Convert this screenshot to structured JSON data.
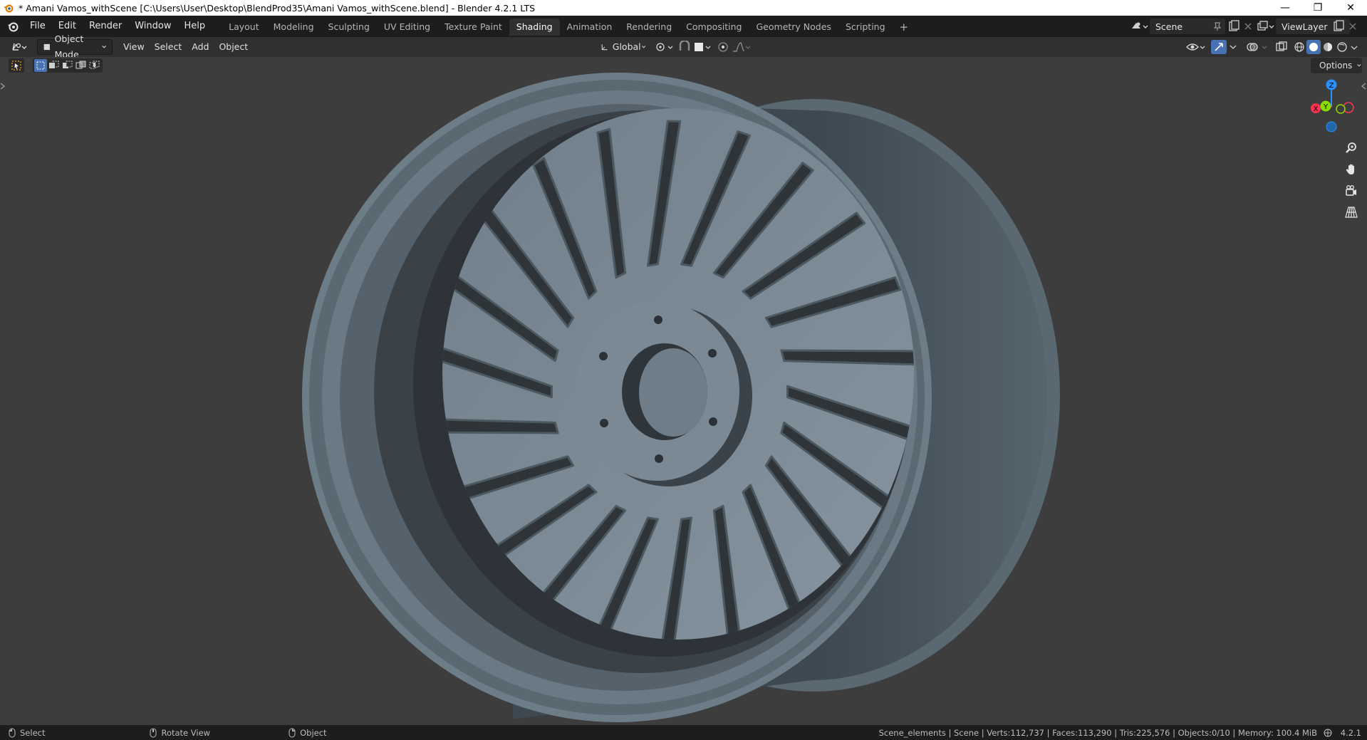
{
  "titlebar": {
    "title": "* Amani Vamos_withScene [C:\\Users\\User\\Desktop\\BlendProd35\\Amani Vamos_withScene.blend] - Blender 4.2.1 LTS",
    "minimize": "—",
    "maximize": "❐",
    "close": "✕"
  },
  "menubar": {
    "menus": [
      "File",
      "Edit",
      "Render",
      "Window",
      "Help"
    ],
    "tabs": [
      "Layout",
      "Modeling",
      "Sculpting",
      "UV Editing",
      "Texture Paint",
      "Shading",
      "Animation",
      "Rendering",
      "Compositing",
      "Geometry Nodes",
      "Scripting"
    ],
    "active_tab": "Shading",
    "add_tab": "+",
    "scene": "Scene",
    "view_layer": "ViewLayer"
  },
  "header": {
    "mode": "Object Mode",
    "menus": [
      "View",
      "Select",
      "Add",
      "Object"
    ],
    "transform_orientation": "Global",
    "options": "Options"
  },
  "gizmo": {
    "z_label": "Z",
    "y_label": "Y",
    "x_label": "X"
  },
  "colors": {
    "accent": "#4772b3",
    "x_axis": "#ff3352",
    "y_axis": "#8bdc00",
    "z_axis": "#2890ff",
    "rim": "#5f707c"
  },
  "statusbar": {
    "select": "Select",
    "rotate_view": "Rotate View",
    "object": "Object",
    "stats": "Scene_elements | Scene | Verts:112,737 | Faces:113,290 | Tris:225,576 | Objects:0/10 | Memory: 100.4 MiB",
    "version": "4.2.1"
  }
}
